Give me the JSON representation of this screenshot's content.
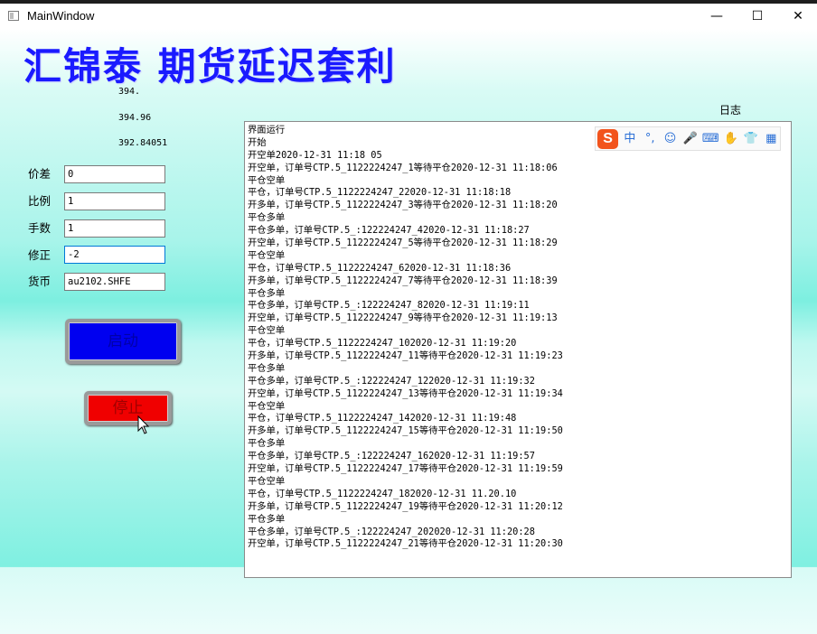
{
  "window": {
    "title": "MainWindow",
    "controls": {
      "minimize": "—",
      "maximize": "☐",
      "close": "✕"
    }
  },
  "app": {
    "heading": "汇锦泰 期货延迟套利"
  },
  "values": [
    "394.",
    "394.96",
    "392.84051"
  ],
  "log_title": "日志",
  "form": {
    "fields": [
      {
        "label": "价差",
        "value": "0"
      },
      {
        "label": "比例",
        "value": "1"
      },
      {
        "label": "手数",
        "value": "1"
      },
      {
        "label": "修正",
        "value": "-2"
      },
      {
        "label": "货币",
        "value": "au2102.SHFE"
      }
    ],
    "start_button": "启动",
    "stop_button": "停止"
  },
  "log": [
    "界面运行",
    "开始",
    "开空单2020-12-31 11:18 05",
    "开空单，订单号CTP.5_1122224247_1等待平仓2020-12-31 11:18:06",
    "平仓空单",
    "平仓，订单号CTP.5_1122224247_22020-12-31 11:18:18",
    "开多单，订单号CTP.5_1122224247_3等待平仓2020-12-31 11:18:20",
    "平仓多单",
    "平仓多单，订单号CTP.5_:122224247_42020-12-31 11:18:27",
    "开空单，订单号CTP.5_1122224247_5等待平仓2020-12-31 11:18:29",
    "平仓空单",
    "平仓，订单号CTP.5_1122224247_62020-12-31 11:18:36",
    "开多单，订单号CTP.5_1122224247_7等待平仓2020-12-31 11:18:39",
    "平仓多单",
    "平仓多单，订单号CTP.5_:122224247_82020-12-31 11:19:11",
    "开空单，订单号CTP.5_1122224247_9等待平仓2020-12-31 11:19:13",
    "平仓空单",
    "平仓，订单号CTP.5_1122224247_102020-12-31 11:19:20",
    "开多单，订单号CTP.5_1122224247_11等待平仓2020-12-31 11:19:23",
    "平仓多单",
    "平仓多单，订单号CTP.5_:122224247_122020-12-31 11:19:32",
    "开空单，订单号CTP.5_1122224247_13等待平仓2020-12-31 11:19:34",
    "平仓空单",
    "平仓，订单号CTP.5_1122224247_142020-12-31 11:19:48",
    "开多单，订单号CTP.5_1122224247_15等待平仓2020-12-31 11:19:50",
    "平仓多单",
    "平仓多单，订单号CTP.5_:122224247_162020-12-31 11:19:57",
    "开空单，订单号CTP.5_1122224247_17等待平仓2020-12-31 11:19:59",
    "平仓空单",
    "平仓，订单号CTP.5_1122224247_182020-12-31 11.20.10",
    "开多单，订单号CTP.5_1122224247_19等待平仓2020-12-31 11:20:12",
    "平仓多单",
    "平仓多单，订单号CTP.5_:122224247_202020-12-31 11:20:28",
    "开空单，订单号CTP.5_1122224247_21等待平仓2020-12-31 11:20:30"
  ],
  "ime_toolbar": {
    "logo": "S",
    "items": [
      {
        "icon": "chinese-mode-icon",
        "glyph": "中"
      },
      {
        "icon": "punctuation-icon",
        "glyph": "°,"
      },
      {
        "icon": "emoji-icon",
        "glyph": "☺"
      },
      {
        "icon": "microphone-icon",
        "glyph": "🎤"
      },
      {
        "icon": "keyboard-icon",
        "glyph": "⌨"
      },
      {
        "icon": "hand-icon",
        "glyph": "✋"
      },
      {
        "icon": "skin-icon",
        "glyph": "👕"
      },
      {
        "icon": "toolbox-icon",
        "glyph": "▦"
      }
    ]
  },
  "colors": {
    "heading": "#1a1aff",
    "start_button": "#0000f0",
    "stop_button": "#f00000",
    "background_accent": "#7defe0"
  }
}
